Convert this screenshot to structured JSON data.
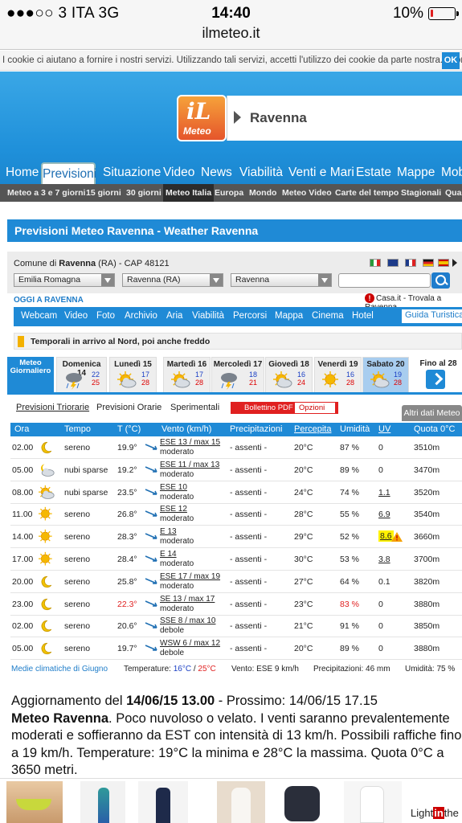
{
  "status_bar": {
    "carrier": "●●●○○ 3 ITA  3G",
    "time": "14:40",
    "battery": "10%",
    "battery_level": 0.1,
    "url": "ilmeteo.it"
  },
  "cookie": {
    "text": "I cookie ci aiutano a fornire i nostri servizi. Utilizzando tali servizi, accetti l'utilizzo dei cookie da parte nostra. Informazioni",
    "ok": "OK"
  },
  "header": {
    "logo_il": "iL",
    "logo_meteo": "Meteo",
    "city": "Ravenna"
  },
  "nav": {
    "items": [
      "Home",
      "Previsioni",
      "Situazione",
      "Video",
      "News",
      "Viabilità",
      "Venti e Mari",
      "Estate",
      "Mappe",
      "Mob"
    ],
    "active": "Previsioni"
  },
  "subnav": {
    "items": [
      "Meteo a 3 e 7 giorni",
      "15 giorni",
      "30 giorni",
      "Meteo Italia",
      "Europa",
      "Mondo",
      "Meteo Video",
      "Carte del tempo",
      "Stagionali",
      "Qual"
    ],
    "active": "Meteo Italia"
  },
  "title": "Previsioni Meteo Ravenna - Weather Ravenna",
  "location": {
    "label_prefix": "Comune di ",
    "city": "Ravenna",
    "label_suffix": " (RA) - CAP 48121",
    "select_region": "Emilia Romagna",
    "select_province": "Ravenna (RA)",
    "select_city": "Ravenna",
    "search_placeholder": ""
  },
  "oggi": {
    "title": "OGGI A RAVENNA",
    "casa": "Casa.it - Trovala a Ravenna",
    "bar": [
      "Webcam",
      "Video",
      "Foto",
      "Archivio",
      "Aria",
      "Viabilità",
      "Percorsi",
      "Mappa",
      "Cinema",
      "Hotel"
    ],
    "guida": "Guida Turistica"
  },
  "alert": "Temporali in arrivo al Nord, poi anche freddo",
  "days": {
    "giornaliero": "Meteo Giornaliero",
    "items": [
      {
        "name": "Domenica 14",
        "min": "22",
        "max": "25",
        "icon": "storm-icon"
      },
      {
        "name": "Lunedì 15",
        "min": "17",
        "max": "28",
        "icon": "sun-cloud-icon"
      },
      {
        "name": "Martedì 16",
        "min": "17",
        "max": "28",
        "icon": "sun-cloud-icon"
      },
      {
        "name": "Mercoledì 17",
        "min": "18",
        "max": "21",
        "icon": "storm-icon"
      },
      {
        "name": "Giovedì 18",
        "min": "16",
        "max": "24",
        "icon": "sun-cloud-icon"
      },
      {
        "name": "Venerdì 19",
        "min": "16",
        "max": "28",
        "icon": "sun-icon"
      },
      {
        "name": "Sabato 20",
        "min": "19",
        "max": "28",
        "icon": "sun-cloud-icon"
      }
    ],
    "fino": "Fino al 28"
  },
  "forecast_tabs": {
    "triorarie": "Previsioni Triorarie",
    "orarie": "Previsioni Orarie",
    "sperimentali": "Sperimentali",
    "pdf": "Bollettino PDF",
    "opzioni": "Opzioni",
    "altri": "Altri dati Meteo"
  },
  "table": {
    "headers": [
      "Ora",
      "Tempo",
      "T (°C)",
      "Vento (km/h)",
      "Precipitazioni",
      "Percepita",
      "Umidità",
      "UV",
      "Quota 0°C"
    ],
    "rows": [
      {
        "ora": "02.00",
        "icon": "moon-icon",
        "tempo": "sereno",
        "t": "19.9°",
        "wind": "ESE 13 / max 15",
        "wind2": "moderato",
        "precip": "- assenti -",
        "perc": "20°C",
        "umid": "87 %",
        "uv": "0",
        "quota": "3510m"
      },
      {
        "ora": "05.00",
        "icon": "cloud-moon-icon",
        "tempo": "nubi sparse",
        "t": "19.2°",
        "wind": "ESE 11 / max 13",
        "wind2": "moderato",
        "precip": "- assenti -",
        "perc": "20°C",
        "umid": "89 %",
        "uv": "0",
        "quota": "3470m"
      },
      {
        "ora": "08.00",
        "icon": "sun-cloud-icon",
        "tempo": "nubi sparse",
        "t": "23.5°",
        "wind": "ESE 10",
        "wind2": "moderato",
        "precip": "- assenti -",
        "perc": "24°C",
        "umid": "74 %",
        "uv": "1.1",
        "quota": "3520m"
      },
      {
        "ora": "11.00",
        "icon": "sun-icon",
        "tempo": "sereno",
        "t": "26.8°",
        "wind": "ESE 12",
        "wind2": "moderato",
        "precip": "- assenti -",
        "perc": "28°C",
        "umid": "55 %",
        "uv": "6.9",
        "quota": "3540m"
      },
      {
        "ora": "14.00",
        "icon": "sun-icon",
        "tempo": "sereno",
        "t": "28.3°",
        "wind": "E 13",
        "wind2": "moderato",
        "precip": "- assenti -",
        "perc": "29°C",
        "umid": "52 %",
        "uv": "8.6",
        "quota": "3660m"
      },
      {
        "ora": "17.00",
        "icon": "sun-icon",
        "tempo": "sereno",
        "t": "28.4°",
        "wind": "E 14",
        "wind2": "moderato",
        "precip": "- assenti -",
        "perc": "30°C",
        "umid": "53 %",
        "uv": "3.8",
        "quota": "3700m"
      },
      {
        "ora": "20.00",
        "icon": "moon-icon",
        "tempo": "sereno",
        "t": "25.8°",
        "wind": "ESE 17 / max 19",
        "wind2": "moderato",
        "precip": "- assenti -",
        "perc": "27°C",
        "umid": "64 %",
        "uv": "0.1",
        "quota": "3820m"
      },
      {
        "ora": "23.00",
        "icon": "moon-icon",
        "tempo": "sereno",
        "t": "22.3°",
        "wind": "SE 13 / max 17",
        "wind2": "moderato",
        "precip": "- assenti -",
        "perc": "23°C",
        "umid": "83 %",
        "uv": "0",
        "quota": "3880m"
      },
      {
        "ora": "02.00",
        "icon": "moon-icon",
        "tempo": "sereno",
        "t": "20.6°",
        "wind": "SSE 8 / max 10",
        "wind2": "debole",
        "precip": "- assenti -",
        "perc": "21°C",
        "umid": "91 %",
        "uv": "0",
        "quota": "3850m"
      },
      {
        "ora": "05.00",
        "icon": "moon-icon",
        "tempo": "sereno",
        "t": "19.7°",
        "wind": "WSW 6 / max 12",
        "wind2": "debole",
        "precip": "- assenti -",
        "perc": "20°C",
        "umid": "89 %",
        "uv": "0",
        "quota": "3880m"
      }
    ]
  },
  "caption": {
    "medie": "Medie climatiche di Giugno",
    "temp_label": "Temperature: ",
    "tmin": "16°C",
    "sep": " / ",
    "tmax": "25°C",
    "vento": "Vento: ESE 9 km/h",
    "precip": "Precipitazioni: 46 mm",
    "umid": "Umidità: 75 %"
  },
  "update": {
    "prefix": "Aggiornamento del ",
    "date": "14/06/15 13.00",
    "next": " - Prossimo: 14/06/15 17.15",
    "bold": "Meteo Ravenna",
    "text": ". Poco nuvoloso o velato. I venti saranno prevalentemente moderati e soffieranno da EST con intensità di 13 km/h. Possibili raffiche fino a 19 km/h. Temperature: 19°C la minima e 28°C la massima. Quota 0°C a 3650 metri."
  },
  "ad": {
    "brand_a": "Light",
    "brand_b": "in",
    "brand_c": "the"
  }
}
